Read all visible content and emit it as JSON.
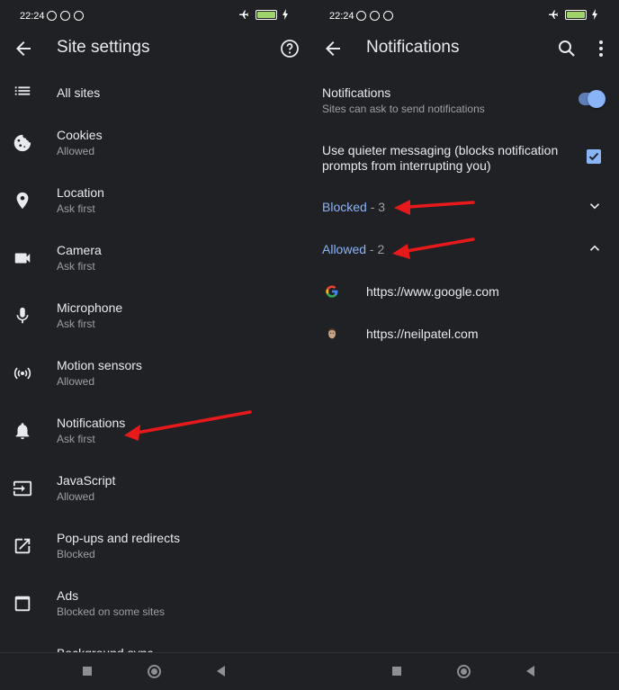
{
  "status": {
    "time": "22:24"
  },
  "left": {
    "title": "Site settings",
    "items": [
      {
        "title": "All sites",
        "subtitle": "",
        "icon": "list-icon"
      },
      {
        "title": "Cookies",
        "subtitle": "Allowed",
        "icon": "cookie-icon"
      },
      {
        "title": "Location",
        "subtitle": "Ask first",
        "icon": "location-pin-icon"
      },
      {
        "title": "Camera",
        "subtitle": "Ask first",
        "icon": "camera-icon"
      },
      {
        "title": "Microphone",
        "subtitle": "Ask first",
        "icon": "microphone-icon"
      },
      {
        "title": "Motion sensors",
        "subtitle": "Allowed",
        "icon": "motion-sensors-icon"
      },
      {
        "title": "Notifications",
        "subtitle": "Ask first",
        "icon": "bell-icon"
      },
      {
        "title": "JavaScript",
        "subtitle": "Allowed",
        "icon": "javascript-icon"
      },
      {
        "title": "Pop-ups and redirects",
        "subtitle": "Blocked",
        "icon": "popup-icon"
      },
      {
        "title": "Ads",
        "subtitle": "Blocked on some sites",
        "icon": "ads-icon"
      },
      {
        "title": "Background sync",
        "subtitle": "",
        "icon": "sync-icon"
      }
    ]
  },
  "right": {
    "title": "Notifications",
    "notifications": {
      "title": "Notifications",
      "subtitle": "Sites can ask to send notifications",
      "enabled": true
    },
    "quieter": {
      "line1": "Use quieter messaging (blocks notification",
      "line2": "prompts from interrupting you)",
      "checked": true
    },
    "blocked": {
      "label": "Blocked",
      "count": " - 3"
    },
    "allowed": {
      "label": "Allowed",
      "count": " - 2"
    },
    "sites": [
      {
        "url": "https://www.google.com",
        "icon": "google-favicon-icon"
      },
      {
        "url": "https://neilpatel.com",
        "icon": "neilpatel-favicon-icon"
      }
    ]
  },
  "colors": {
    "background": "#202124",
    "accent": "#8ab4f8",
    "annotation": "#e8191b"
  }
}
